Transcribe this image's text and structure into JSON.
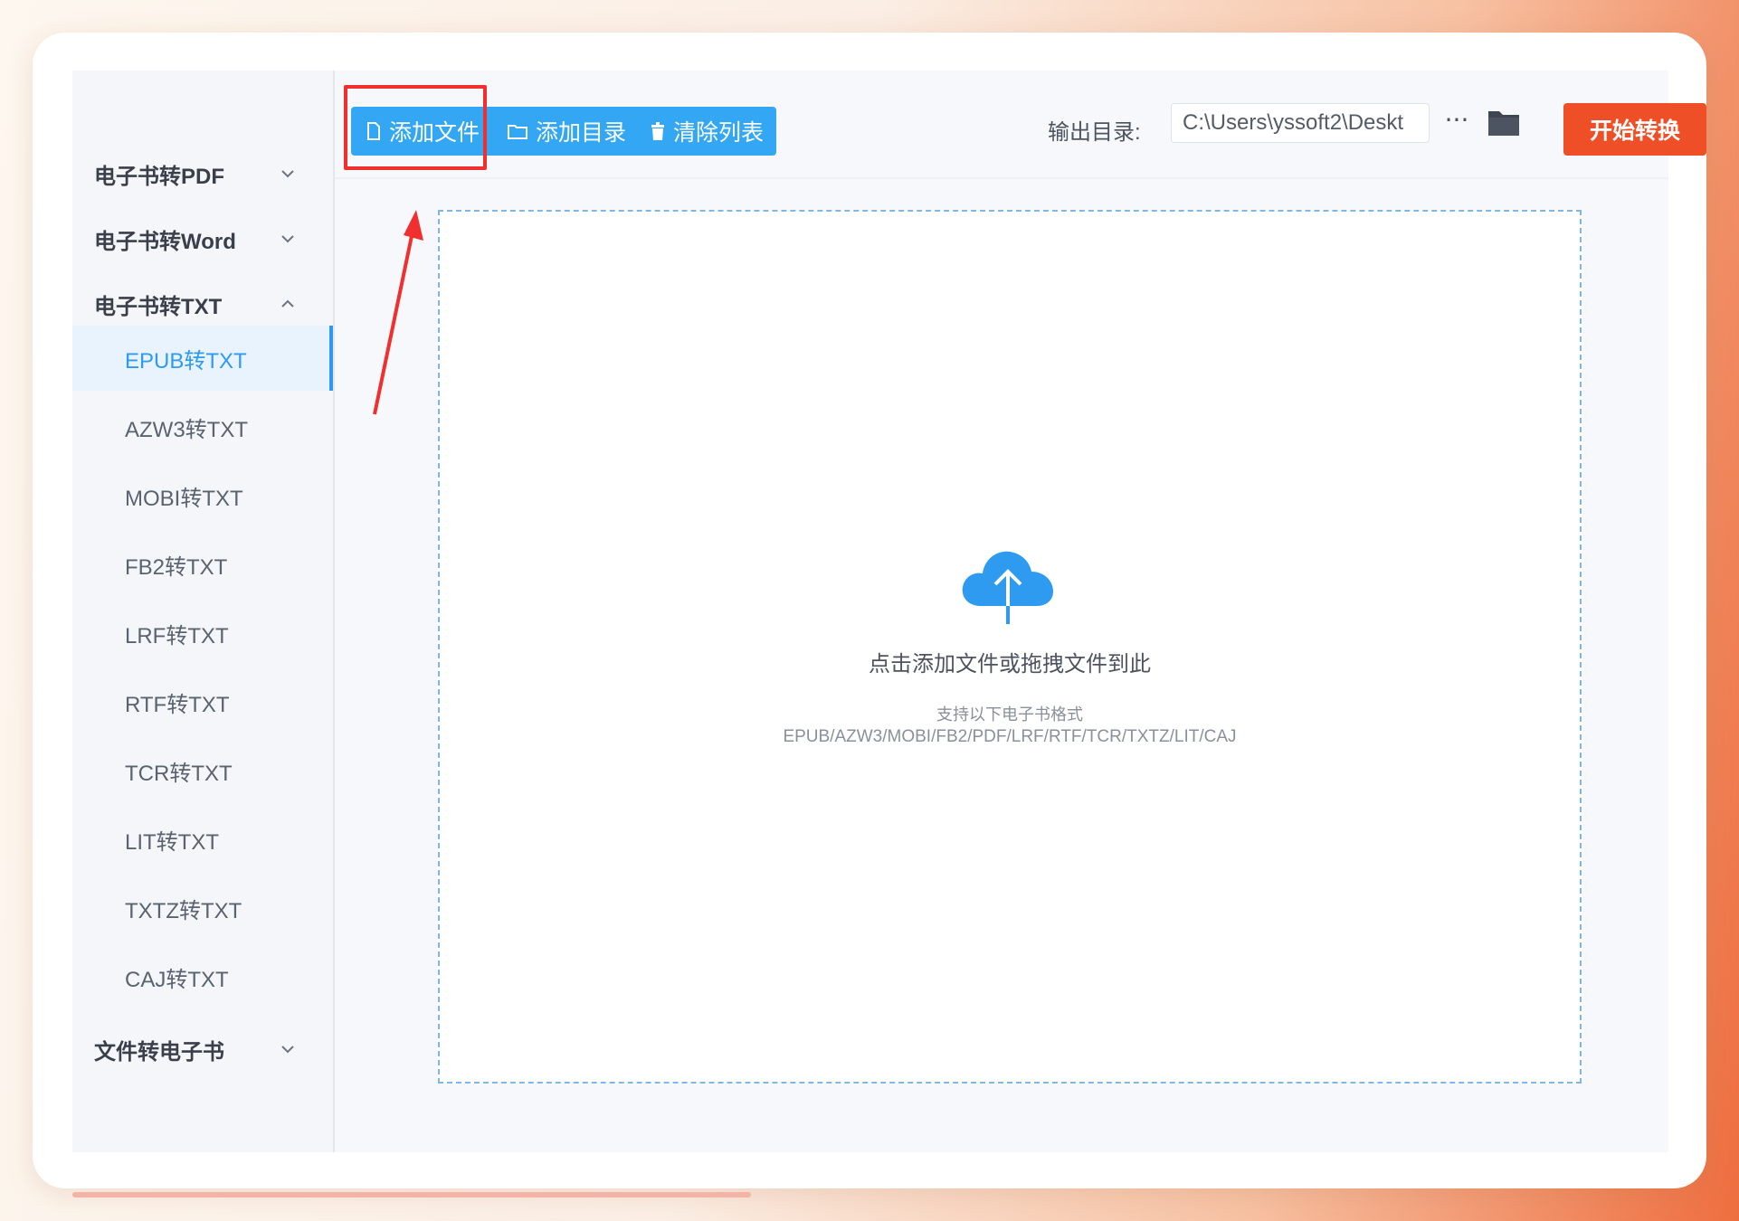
{
  "sidebar": {
    "groups": [
      {
        "label": "电子书转PDF"
      },
      {
        "label": "电子书转Word"
      },
      {
        "label": "电子书转TXT"
      },
      {
        "label": "文件转电子书"
      }
    ],
    "txt_items": [
      {
        "label": "EPUB转TXT"
      },
      {
        "label": "AZW3转TXT"
      },
      {
        "label": "MOBI转TXT"
      },
      {
        "label": "FB2转TXT"
      },
      {
        "label": "LRF转TXT"
      },
      {
        "label": "RTF转TXT"
      },
      {
        "label": "TCR转TXT"
      },
      {
        "label": "LIT转TXT"
      },
      {
        "label": "TXTZ转TXT"
      },
      {
        "label": "CAJ转TXT"
      }
    ],
    "active_item": "EPUB转TXT"
  },
  "toolbar": {
    "add_file_label": "添加文件",
    "add_dir_label": "添加目录",
    "clear_list_label": "清除列表",
    "output_label": "输出目录:",
    "output_path": "C:\\Users\\yssoft2\\Deskt",
    "more_label": "···",
    "start_label": "开始转换"
  },
  "dropzone": {
    "main_text": "点击添加文件或拖拽文件到此",
    "sub_text": "支持以下电子书格式",
    "formats_text": "EPUB/AZW3/MOBI/FB2/PDF/LRF/RTF/TCR/TXTZ/LIT/CAJ"
  },
  "icons": {
    "file": "file-icon",
    "folder": "folder-icon",
    "trash": "trash-icon",
    "cloud_upload": "cloud-upload-icon",
    "chevron_down": "chevron-down-icon",
    "chevron_up": "chevron-up-icon"
  },
  "colors": {
    "accent": "#33a7f4",
    "start_button": "#ee4f27",
    "highlight": "#f12f2f",
    "active_item": "#2e9bf0"
  }
}
